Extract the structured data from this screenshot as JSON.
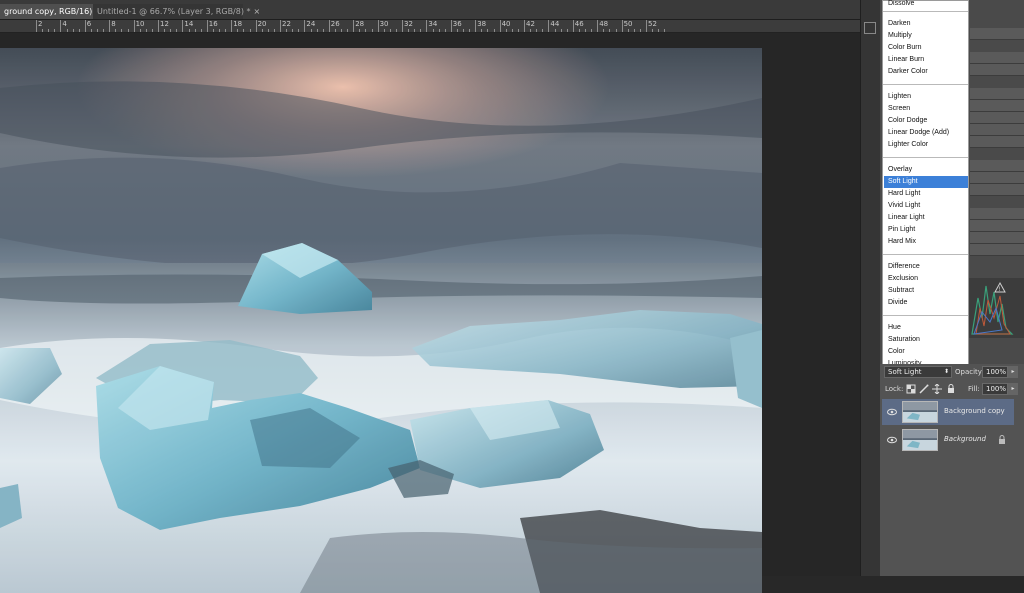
{
  "tabs": [
    {
      "label": "ground copy, RGB/16) *",
      "close": "×"
    },
    {
      "label": "Untitled-1 @ 66.7% (Layer 3, RGB/8) *",
      "close": "×"
    }
  ],
  "ruler_labels": [
    "2",
    "4",
    "6",
    "8",
    "10",
    "12",
    "14",
    "16",
    "18",
    "20",
    "22",
    "24",
    "26",
    "28",
    "30",
    "32",
    "34",
    "36",
    "38",
    "40",
    "42",
    "44",
    "46",
    "48",
    "50",
    "52"
  ],
  "blend_modes": {
    "partial_top": "Dissolve",
    "groups": [
      [
        "Darken",
        "Multiply",
        "Color Burn",
        "Linear Burn",
        "Darker Color"
      ],
      [
        "Lighten",
        "Screen",
        "Color Dodge",
        "Linear Dodge (Add)",
        "Lighter Color"
      ],
      [
        "Overlay",
        "Soft Light",
        "Hard Light",
        "Vivid Light",
        "Linear Light",
        "Pin Light",
        "Hard Mix"
      ],
      [
        "Difference",
        "Exclusion",
        "Subtract",
        "Divide"
      ],
      [
        "Hue",
        "Saturation",
        "Color",
        "Luminosity"
      ]
    ],
    "selected": "Soft Light"
  },
  "layers_panel": {
    "blend_value": "Soft Light",
    "opacity_label": "Opacity:",
    "opacity_value": "100%",
    "lock_label": "Lock:",
    "fill_label": "Fill:",
    "fill_value": "100%",
    "layers": [
      {
        "name": "Background copy",
        "selected": true,
        "locked": false
      },
      {
        "name": "Background",
        "selected": false,
        "locked": true
      }
    ]
  },
  "colors": {
    "accent": "#3c80d8",
    "selected_layer": "#5c6b86",
    "panel": "#535353"
  }
}
